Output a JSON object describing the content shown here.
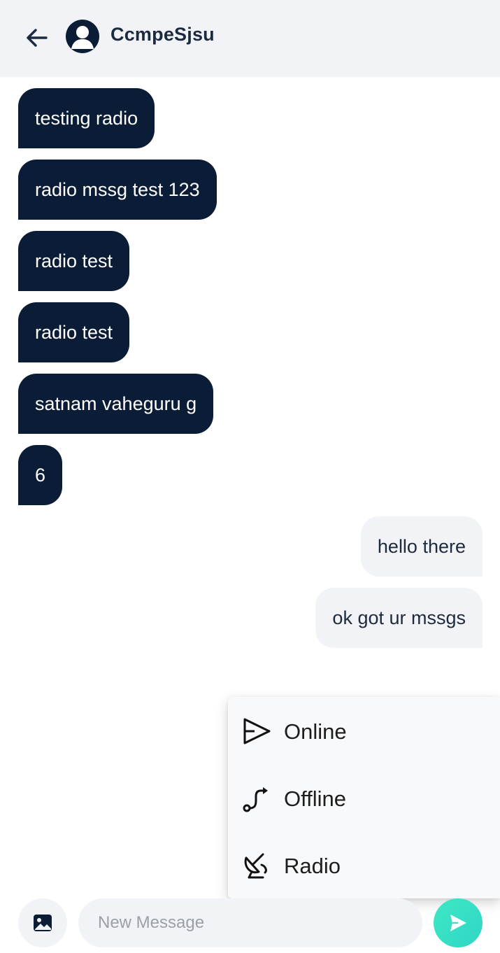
{
  "header": {
    "contact_name": "CcmpeSjsu"
  },
  "messages": [
    {
      "direction": "in",
      "text": "testing radio"
    },
    {
      "direction": "in",
      "text": "radio mssg test 123"
    },
    {
      "direction": "in",
      "text": "radio test"
    },
    {
      "direction": "in",
      "text": "radio test"
    },
    {
      "direction": "in",
      "text": "satnam vaheguru g"
    },
    {
      "direction": "in",
      "text": "6"
    },
    {
      "direction": "out",
      "text": "hello there"
    },
    {
      "direction": "out",
      "text": "ok got ur mssgs"
    }
  ],
  "send_menu": {
    "items": [
      {
        "label": "Online",
        "icon": "send-outline-icon"
      },
      {
        "label": "Offline",
        "icon": "route-icon"
      },
      {
        "label": "Radio",
        "icon": "satellite-dish-icon"
      }
    ]
  },
  "composer": {
    "placeholder": "New Message",
    "value": ""
  },
  "colors": {
    "incoming_bubble": "#0b1c36",
    "outgoing_bubble": "#f1f3f6",
    "header_bg": "#f1f3f6",
    "send_button": "#2fd6c5"
  }
}
